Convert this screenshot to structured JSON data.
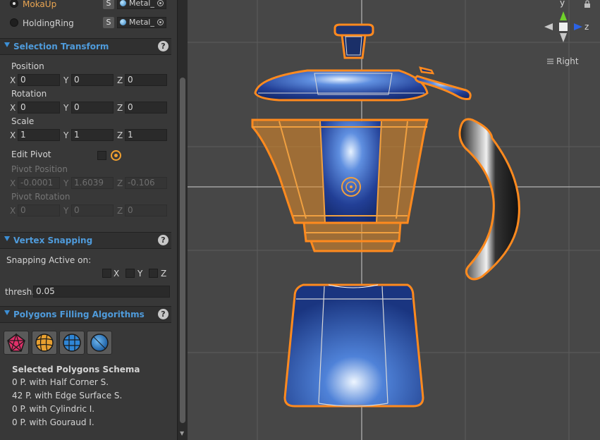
{
  "objects": [
    {
      "name": "MokaUp",
      "s_label": "S",
      "material": "Metal_",
      "selected": true
    },
    {
      "name": "HoldingRing",
      "s_label": "S",
      "material": "Metal_",
      "selected": false
    }
  ],
  "selection_transform": {
    "title": "Selection Transform",
    "help": "?",
    "position_label": "Position",
    "position": {
      "x": "0",
      "y": "0",
      "z": "0"
    },
    "rotation_label": "Rotation",
    "rotation": {
      "x": "0",
      "y": "0",
      "z": "0"
    },
    "scale_label": "Scale",
    "scale": {
      "x": "1",
      "y": "1",
      "z": "1"
    },
    "edit_pivot_label": "Edit Pivot",
    "pivot_position_label": "Pivot Position",
    "pivot_position": {
      "x": "-0.0001",
      "y": "1.6039",
      "z": "-0.106"
    },
    "pivot_rotation_label": "Pivot Rotation",
    "pivot_rotation": {
      "x": "0",
      "y": "0",
      "z": "0"
    }
  },
  "axes": {
    "x": "X",
    "y": "Y",
    "z": "Z"
  },
  "vertex_snapping": {
    "title": "Vertex Snapping",
    "help": "?",
    "active_label": "Snapping Active on:",
    "thresh_label": "thresh.",
    "thresh_value": "0.05"
  },
  "polygons": {
    "title": "Polygons Filling Algorithms",
    "help": "?",
    "schema_title": "Selected Polygons Schema",
    "lines": [
      "0 P. with Half Corner S.",
      "42 P. with Edge Surface S.",
      "0 P. with Cylindric I.",
      "0 P. with Gouraud I."
    ],
    "button_colors": [
      "#e0306a",
      "#e8a030",
      "#2f86d6",
      "#2f86d6"
    ]
  },
  "scene": {
    "view_label": "Right",
    "gizmo_y": "y",
    "gizmo_z": "z",
    "colors": {
      "selection": "#ff8a1e",
      "face": "#f0a040",
      "metal": "#2a55b8"
    }
  }
}
